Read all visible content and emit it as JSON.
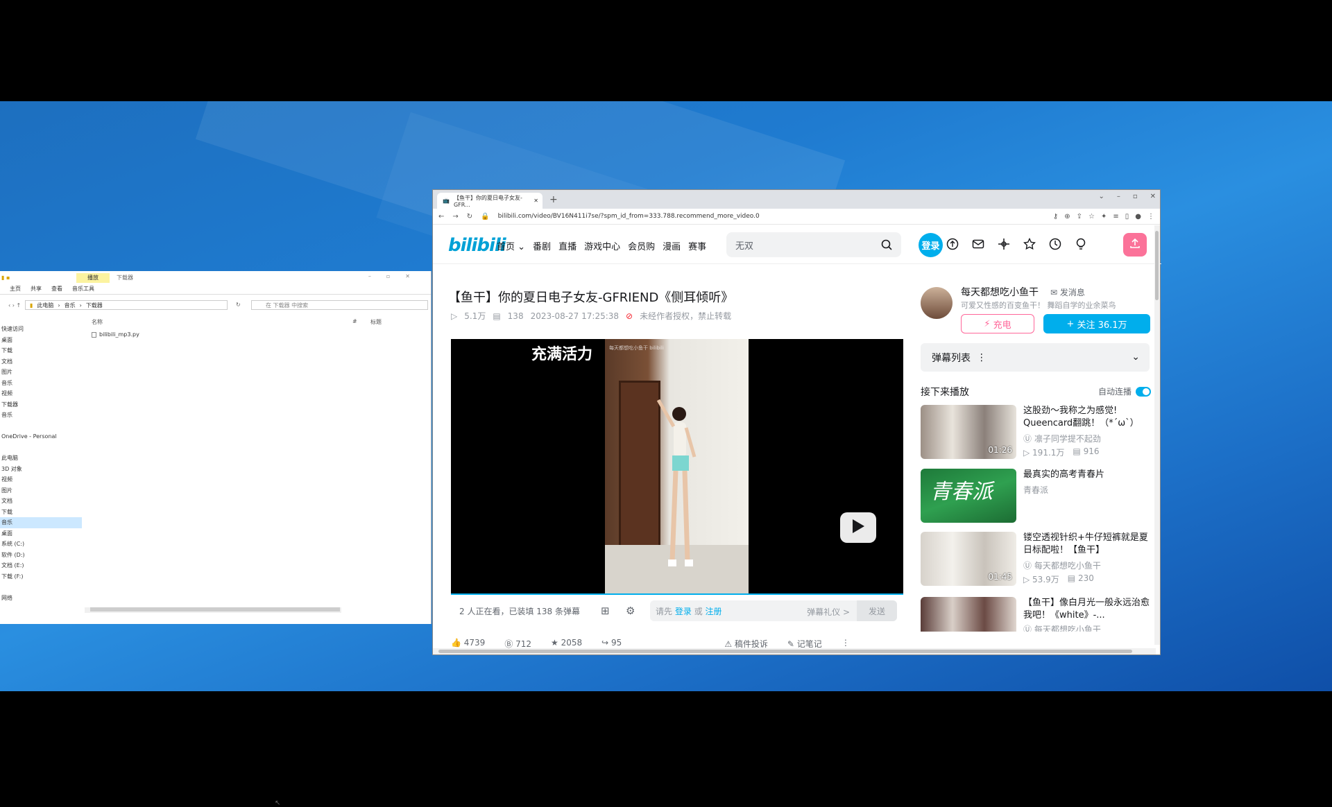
{
  "explorer": {
    "ribbon_tabs": [
      "主页",
      "共享",
      "查看",
      "音乐工具"
    ],
    "manage_tab": "播放",
    "window_title": "下载器",
    "breadcrumb": [
      "此电脑",
      "音乐",
      "下载器"
    ],
    "search_placeholder": "在 下载器 中搜索",
    "col_name": "名称",
    "col_num": "#",
    "col_title": "标题",
    "file": "bilibili_mp3.py",
    "nav": [
      "快速访问",
      "桌面",
      "下载",
      "文档",
      "图片",
      "音乐",
      "视频",
      "下载器",
      "音乐",
      "",
      "OneDrive - Personal",
      "",
      "此电脑",
      "3D 对象",
      "视频",
      "图片",
      "文档",
      "下载",
      "音乐",
      "桌面",
      "系统 (C:)",
      "软件 (D:)",
      "文档 (E:)",
      "下载 (F:)",
      "",
      "网络"
    ],
    "selected_nav": "音乐"
  },
  "chrome": {
    "tab_title": "【鱼干】你的夏日电子女友-GFR...",
    "new_tab": "+",
    "url": "bilibili.com/video/BV16N411i7se/?spm_id_from=333.788.recommend_more_video.0"
  },
  "bili": {
    "logo": "bilibili",
    "nav": [
      "首页",
      "番剧",
      "直播",
      "游戏中心",
      "会员购",
      "漫画",
      "赛事"
    ],
    "search_placeholder": "无双",
    "login": "登录",
    "video": {
      "title": "【鱼干】你的夏日电子女友-GFRIEND《侧耳倾听》",
      "views": "5.1万",
      "danmaku": "138",
      "date": "2023-08-27 17:25:38",
      "notice": "未经作者授权，禁止转载",
      "overlay_text": "充满活力",
      "watermark": "每天都想吃小鱼干 bilibili",
      "watching": "2 人正在看，已装填 138 条弹幕",
      "input_prefix": "请先",
      "input_login": "登录",
      "input_or": "或",
      "input_register": "注册",
      "etiquette": "弹幕礼仪 >",
      "send": "发送",
      "actions": [
        "4739",
        "712",
        "2058",
        "95"
      ],
      "report": "稿件投诉",
      "notes": "记笔记"
    },
    "uploader": {
      "name": "每天都想吃小鱼干",
      "message": "发消息",
      "desc": "可爱又性感的百变鱼干！ 舞蹈自学的业余菜鸟",
      "charge": "充电",
      "follow": "关注 36.1万"
    },
    "danmaku_list": "弹幕列表",
    "next_header": "接下来播放",
    "autoplay": "自动连播",
    "recommendations": [
      {
        "title": "这股劲～我称之为感觉! Queencard翻跳！（*ˊωˋ）",
        "up": "凛子同学提不起劲",
        "views": "191.1万",
        "danmaku": "916",
        "duration": "01:26"
      },
      {
        "title": "最真实的高考青春片",
        "up": "青春派",
        "views": "",
        "danmaku": "",
        "duration": ""
      },
      {
        "title": "镂空透视针织+牛仔短裤就是夏日标配啦！【鱼干】",
        "up": "每天都想吃小鱼干",
        "views": "53.9万",
        "danmaku": "230",
        "duration": "01:45"
      },
      {
        "title": "【鱼干】像白月光一般永远治愈我吧！《white》-...",
        "up": "每天都想吃小鱼干",
        "views": "",
        "danmaku": "",
        "duration": ""
      }
    ]
  },
  "colors": {
    "accent": "#00aeec",
    "pink": "#fb7299",
    "charge": "#ff6699"
  }
}
